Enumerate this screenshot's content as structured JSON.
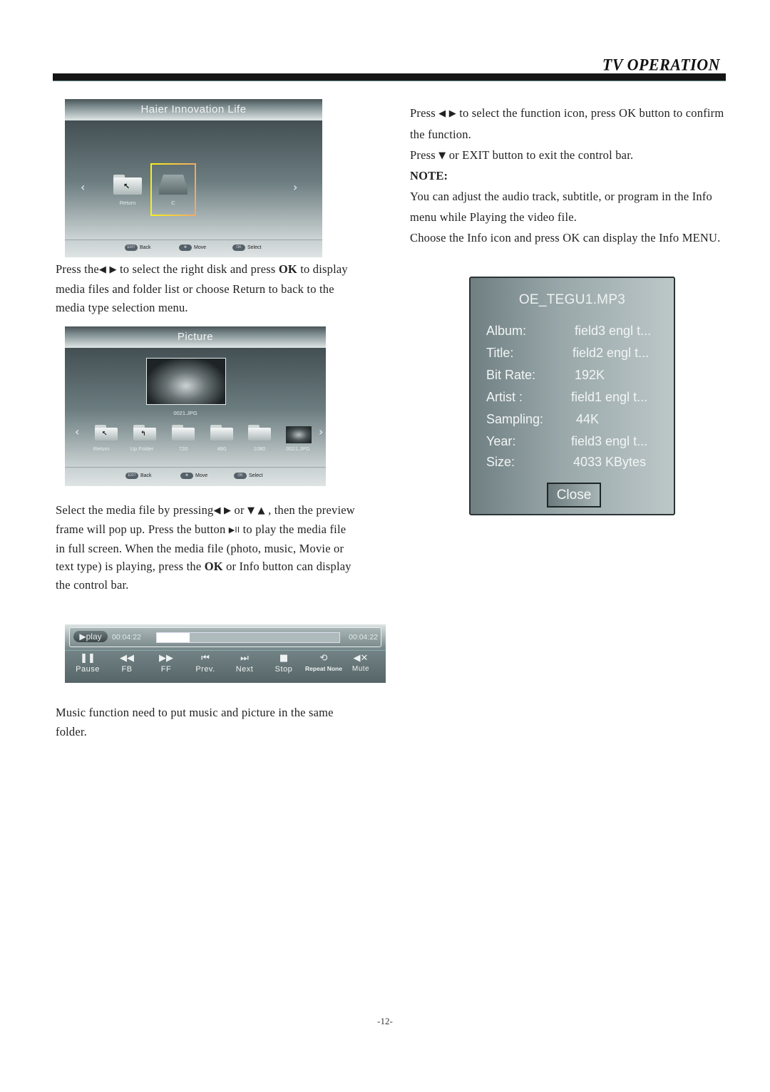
{
  "header": {
    "title": "TV OPERATION"
  },
  "left": {
    "screen1": {
      "title": "Haier Innovation Life",
      "items": [
        {
          "label": "Return",
          "icon": "return-folder-icon"
        },
        {
          "label": "C",
          "icon": "disk-drive-icon",
          "selected": true
        }
      ],
      "footer": [
        {
          "key": "EXIT",
          "label": "Back"
        },
        {
          "key": "move",
          "label": "Move"
        },
        {
          "key": "OK",
          "label": "Select"
        }
      ]
    },
    "para1": {
      "a": "Press the",
      "arrows": "◀ ▶",
      "b": " to select the right disk and press ",
      "ok": "OK",
      "c": " to display media files and folder list or choose Return to back to the media type selection menu."
    },
    "screen2": {
      "title": "Picture",
      "preview_label": "0021.JPG",
      "items": [
        {
          "label": "Return"
        },
        {
          "label": "Up Folder"
        },
        {
          "label": "720"
        },
        {
          "label": "480"
        },
        {
          "label": "1080"
        },
        {
          "label": "0021.JPG"
        }
      ],
      "footer": [
        {
          "key": "EXIT",
          "label": "Back"
        },
        {
          "key": "move",
          "label": "Move"
        },
        {
          "key": "OK",
          "label": "Select"
        }
      ]
    },
    "para2": {
      "a": "Select the media file by pressing",
      "arrows_lr": "◀ ▶",
      "or": " or ",
      "arrows_du": "▼ ▲",
      "b": " , then the preview frame will pop up. Press the button ",
      "playpause": "▶II",
      "c": " to play the media file in full screen. When the media file (photo, music, Movie or text type) is playing, press the ",
      "ok": "OK",
      "d": " or Info button can display the control bar."
    },
    "control_bar": {
      "play_label": "▶play",
      "elapsed": "00:04:22",
      "total": "00:04:22",
      "progress_fraction": 0.18,
      "controls": [
        {
          "label": "Pause",
          "icon": "▌▌"
        },
        {
          "label": "FB",
          "icon": "◀◀"
        },
        {
          "label": "FF",
          "icon": "▶▶"
        },
        {
          "label": "Prev.",
          "icon": "|◀"
        },
        {
          "label": "Next",
          "icon": "▶|"
        },
        {
          "label": "Stop",
          "icon": "■"
        },
        {
          "label": "Repeat None",
          "icon": "⟲"
        },
        {
          "label": "Mute",
          "icon": "🔇"
        }
      ]
    },
    "para3": "Music function need to put music and picture in the same folder."
  },
  "right": {
    "line1a": "Press ",
    "line1arrows": "◀ ▶",
    "line1b": " to select the function icon,  press OK button to confirm  the function.",
    "line2a": "Press ",
    "line2arrow": "▼",
    "line2b": " or EXIT button to exit the control bar.",
    "note_label": "NOTE:",
    "note1": "You can adjust the audio track, subtitle, or program in the Info menu while Playing the video file.",
    "note2": "Choose the Info icon and press OK can display the Info MENU.",
    "info_dialog": {
      "title": "OE_TEGU1.MP3",
      "rows": [
        {
          "label": "Album:",
          "value": "field3  engl t..."
        },
        {
          "label": "Title:",
          "value": "field2  engl t..."
        },
        {
          "label": "Bit Rate:",
          "value": "192K"
        },
        {
          "label": "Artist :",
          "value": "field1  engl t..."
        },
        {
          "label": "Sampling:",
          "value": "44K"
        },
        {
          "label": "Year:",
          "value": "field3  engl t..."
        },
        {
          "label": "Size:",
          "value": "4033 KBytes"
        }
      ],
      "close_label": "Close"
    }
  },
  "page_number": "-12-"
}
